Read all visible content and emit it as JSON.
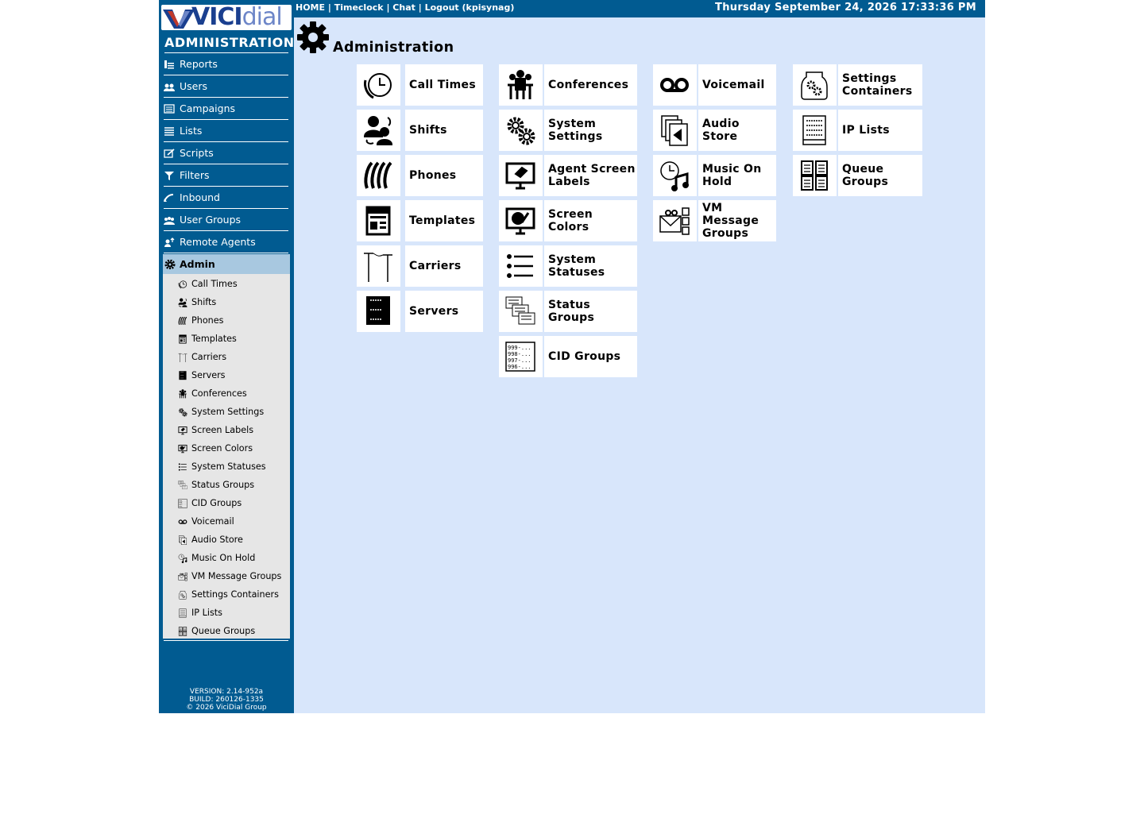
{
  "logo": {
    "vi": "VICI",
    "dial": "dial"
  },
  "sidebar": {
    "section_title": "ADMINISTRATION",
    "items": [
      {
        "label": "Reports",
        "icon": "reports-icon"
      },
      {
        "label": "Users",
        "icon": "users-icon"
      },
      {
        "label": "Campaigns",
        "icon": "campaigns-icon"
      },
      {
        "label": "Lists",
        "icon": "lists-icon"
      },
      {
        "label": "Scripts",
        "icon": "scripts-icon"
      },
      {
        "label": "Filters",
        "icon": "filter-icon"
      },
      {
        "label": "Inbound",
        "icon": "inbound-icon"
      },
      {
        "label": "User Groups",
        "icon": "user-groups-icon"
      },
      {
        "label": "Remote Agents",
        "icon": "remote-agents-icon"
      },
      {
        "label": "Admin",
        "icon": "gear-icon"
      }
    ],
    "submenu": [
      "Call Times",
      "Shifts",
      "Phones",
      "Templates",
      "Carriers",
      "Servers",
      "Conferences",
      "System Settings",
      "Screen Labels",
      "Screen Colors",
      "System Statuses",
      "Status Groups",
      "CID Groups",
      "Voicemail",
      "Audio Store",
      "Music On Hold",
      "VM Message Groups",
      "Settings Containers",
      "IP Lists",
      "Queue Groups"
    ],
    "version": "VERSION: 2.14-952a",
    "build": "BUILD: 260126-1335",
    "copyright": "© 2026 ViciDial Group"
  },
  "header": {
    "home": "HOME",
    "timeclock": "Timeclock",
    "chat": "Chat",
    "logout": "Logout (kpisynag)",
    "separator": " | ",
    "datetime": "Thursday September 24, 2026 17:33:36 PM"
  },
  "main": {
    "title": "Administration",
    "columns": [
      [
        "Call Times",
        "Shifts",
        "Phones",
        "Templates",
        "Carriers",
        "Servers"
      ],
      [
        "Conferences",
        "System Settings",
        "Agent Screen Labels",
        "Screen Colors",
        "System Statuses",
        "Status Groups",
        "CID Groups"
      ],
      [
        "Voicemail",
        "Audio Store",
        "Music On Hold",
        "VM Message Groups"
      ],
      [
        "Settings Containers",
        "IP Lists",
        "Queue Groups"
      ]
    ]
  },
  "colors": {
    "sidebar": "#015b91",
    "main_bg": "#d8e6fb",
    "active": "#a8c8e0",
    "submenu_bg": "#e6e6e6"
  }
}
